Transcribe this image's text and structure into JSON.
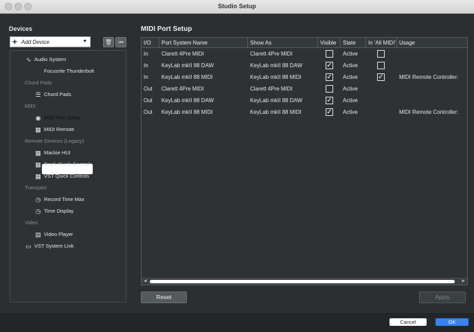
{
  "window": {
    "title": "Studio Setup"
  },
  "sidebar": {
    "heading": "Devices",
    "add_device": "Add Device",
    "tree": [
      {
        "type": "item",
        "label": "Audio System",
        "icon": "waveform-icon",
        "indent": 1
      },
      {
        "type": "item",
        "label": "Focusrite Thunderbolt",
        "icon": "",
        "indent": 2
      },
      {
        "type": "category",
        "label": "Chord Pads"
      },
      {
        "type": "item",
        "label": "Chord Pads",
        "icon": "sliders-icon",
        "indent": 2
      },
      {
        "type": "category",
        "label": "MIDI"
      },
      {
        "type": "item",
        "label": "MIDI Port Setup",
        "icon": "midi-port-icon",
        "indent": 2,
        "selected": true
      },
      {
        "type": "item",
        "label": "MIDI Remote",
        "icon": "keyboard-icon",
        "indent": 2
      },
      {
        "type": "category",
        "label": "Remote Devices (Legacy)"
      },
      {
        "type": "item",
        "label": "Mackie HUI",
        "icon": "keyboard-icon",
        "indent": 2
      },
      {
        "type": "item",
        "label": "Track Quick Controls",
        "icon": "keyboard-icon",
        "indent": 2
      },
      {
        "type": "item",
        "label": "VST Quick Controls",
        "icon": "keyboard-icon",
        "indent": 2
      },
      {
        "type": "category",
        "label": "Transport"
      },
      {
        "type": "item",
        "label": "Record Time Max",
        "icon": "clock-icon",
        "indent": 2
      },
      {
        "type": "item",
        "label": "Time Display",
        "icon": "clock-icon",
        "indent": 2
      },
      {
        "type": "category",
        "label": "Video"
      },
      {
        "type": "item",
        "label": "Video Player",
        "icon": "film-icon",
        "indent": 2
      },
      {
        "type": "item",
        "label": "VST System Link",
        "icon": "monitor-icon",
        "indent": 1
      }
    ]
  },
  "main": {
    "title": "MIDI Port Setup",
    "columns": [
      "I/O",
      "Port System Name",
      "Show As",
      "Visible",
      "State",
      "In 'All MIDI'",
      "Usage"
    ],
    "rows": [
      {
        "io": "In",
        "port": "Clarett 4Pre MIDI",
        "show_as": "Clarett 4Pre MIDI",
        "visible": false,
        "state": "Active",
        "all_midi": false,
        "usage": ""
      },
      {
        "io": "In",
        "port": "KeyLab mkII 88 DAW",
        "show_as": "KeyLab mkII 88 DAW",
        "visible": true,
        "state": "Active",
        "all_midi": false,
        "usage": ""
      },
      {
        "io": "In",
        "port": "KeyLab mkII 88 MIDI",
        "show_as": "KeyLab mkII 88 MIDI",
        "visible": true,
        "state": "Active",
        "all_midi": true,
        "usage": "MIDI Remote Controller:"
      },
      {
        "io": "Out",
        "port": "Clarett 4Pre MIDI",
        "show_as": "Clarett 4Pre MIDI",
        "visible": false,
        "state": "Active",
        "all_midi": null,
        "usage": ""
      },
      {
        "io": "Out",
        "port": "KeyLab mkII 88 DAW",
        "show_as": "KeyLab mkII 88 DAW",
        "visible": true,
        "state": "Active",
        "all_midi": null,
        "usage": ""
      },
      {
        "io": "Out",
        "port": "KeyLab mkII 88 MIDI",
        "show_as": "KeyLab mkII 88 MIDI",
        "visible": true,
        "state": "Active",
        "all_midi": null,
        "usage": "MIDI Remote Controller:"
      }
    ]
  },
  "buttons": {
    "reset": "Reset",
    "apply": "Apply",
    "cancel": "Cancel",
    "ok": "OK"
  },
  "colors": {
    "accent": "#3a82f0",
    "background": "#2b2f32"
  }
}
